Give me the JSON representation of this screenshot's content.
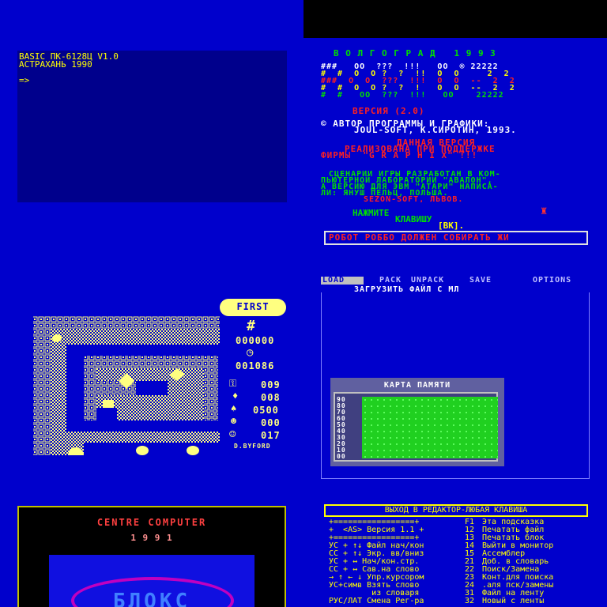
{
  "basic": {
    "line1": "BASIC ПК-6128Ц V1.0",
    "line2": "АСТРАХАНЬ 1990",
    "prompt": "=>"
  },
  "robbo": {
    "title": "В О Л Г О Г Р А Д   1 9 9 3",
    "logo_lines": [
      "###   OO  ???  !!!   OO  ® 22222",
      "#  #  O  O ?  ?  !!  O  O     2  2",
      "###  O  O  ???  !!!  O  O  --  2  2",
      "#  #  O  O ?  ?  !   O  O  --  2  2",
      "#  #   OO  ???  !!!   OO    22222"
    ],
    "version": "ВЕРСИЯ (2.0)",
    "author1": "© АВТОР ПРОГРАММЫ И ГРАФИКИ:",
    "author2": "JOUL-SOFT, К.СИРОТИН, 1993.",
    "sponsor1": "ДАННАЯ ВЕРСИЯ",
    "sponsor2": "РЕАЛИЗОВАНА ПРИ ПОДДЕРЖКЕ",
    "sponsor3": "ФИРМЫ  \"G R A P H I X\" !!!",
    "scen1": "СЦЕНАРИИ ИГРЫ РАЗРАБОТАН В КОМ-",
    "scen2": "ПЬЮТЕРНОЙ ЛАБОРАТОРИИ \"АВАЛОН\",",
    "scen3": "А ВЕРСИЮ ДЛЯ ЭВМ \"АТАРИ\" НАПИСА-",
    "scen4": "ЛИ: ЯНУШ ПЕЛЬЦ, ПОЛЬША.",
    "scen5": "SEZON-SOFT, ЛЬВОВ.",
    "press1": "НАЖМИТЕ",
    "press2": "КЛАВИШУ",
    "press3": "[ВК].",
    "ticker": "РОБОТ РОББО ДОЛЖЕН СОБИРАТЬ ЖИ"
  },
  "game": {
    "badge": "FIRST",
    "hash": "#",
    "score": "000000",
    "time": "001086",
    "c1": "009",
    "c2": "008",
    "c3": "0500",
    "c4": "000",
    "c5": "017",
    "author": "D.BYFORD"
  },
  "loader": {
    "menu": [
      "LOAD",
      "PACK",
      "UNPACK",
      "SAVE",
      "OPTIONS"
    ],
    "status": "ЗАГРУЗИТЬ ФАЙЛ С МЛ",
    "map_title": "КАРТА ПАМЯТИ",
    "rows": [
      "90",
      "80",
      "70",
      "60",
      "50",
      "40",
      "30",
      "20",
      "10",
      "00"
    ]
  },
  "centre": {
    "title": "CENTRE COMPUTER",
    "year": "1 9 9 1",
    "logo": "БЛОКС"
  },
  "editor": {
    "header": "ВЫХОД В РЕДАКТОР-ЛЮБАЯ КЛАВИША",
    "rows": [
      [
        "+=================+",
        "F1",
        "Эта подсказка"
      ],
      [
        "+  <AS> Версия 1.1 +",
        "12",
        "Печатать файл"
      ],
      [
        "+=================+",
        "13",
        "Печатать блок"
      ],
      [
        "УС + ↑↓ Файл нач/кон",
        "14",
        "Выйти в монитор"
      ],
      [
        "СС + ↑↓ Экр. вв/вниз",
        "15",
        "Ассемблер"
      ],
      [
        "УС + ↔ Нач/кон.стр.",
        "21",
        "Доб. в словарь"
      ],
      [
        "СС + ↔ Сав.на слово",
        "22",
        "Поиск/Замена"
      ],
      [
        "→ ↑ ← ↓ Упр.курсором",
        "23",
        "Конт.для поиска"
      ],
      [
        "УС+симв Взять слово",
        "24",
        ".аля пск/замены"
      ],
      [
        "         из словаря",
        "31",
        "Файл на ленту"
      ],
      [
        "РУС/ЛАТ Смена Рег-ра",
        "32",
        "Новый с ленты"
      ]
    ]
  }
}
